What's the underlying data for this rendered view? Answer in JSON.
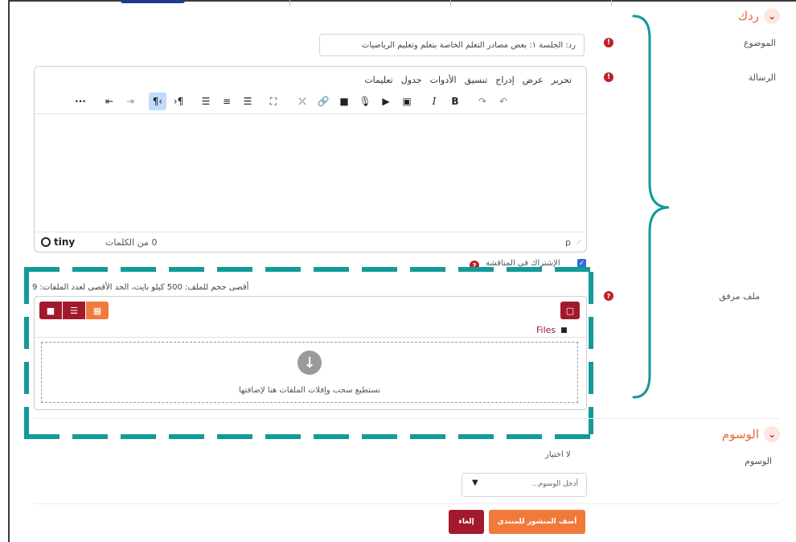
{
  "reply_section": {
    "title": "ردك",
    "subject_label": "الموضوع",
    "subject_value": "رد: الجلسة ١: بعض مصادر التعلم الخاصة بتعلم وتعليم الرياضيات",
    "message_label": "الرسالة",
    "attachment_label": "ملف مرفق"
  },
  "editor": {
    "menu": [
      "تحرير",
      "عرض",
      "إدراج",
      "تنسيق",
      "الأدوات",
      "جدول",
      "تعليمات"
    ],
    "word_count": "0 من الكلمات",
    "brand": "tiny",
    "path": "p"
  },
  "subscribe": {
    "label": "الإشتراك في المناقشة",
    "checked": true
  },
  "filepicker": {
    "limits": "أقصى حجم للملف: 500 كيلو بايت، الحد الأقصى لعدد الملفات: 9",
    "folder_name": "Files",
    "drop_text": "تستطيع سحب وإفلات الملفات هنا لإضافتها"
  },
  "tags_section": {
    "title": "الوسوم",
    "tags_label": "الوسوم",
    "no_selection": "لا اختيار",
    "tags_placeholder": "أدخل الوسوم..."
  },
  "actions": {
    "submit_label": "أضف المنشور للمنتدى",
    "cancel_label": "إلغاء"
  },
  "colors": {
    "accent_orange": "#f07a3a",
    "brand_dark_red": "#a3192c",
    "annotation_teal": "#139a9a"
  },
  "icons": [
    "undo-icon",
    "redo-icon",
    "bold-icon",
    "italic-icon",
    "image-icon",
    "media-icon",
    "record-audio-icon",
    "record-video-icon",
    "link-icon",
    "unlink-icon",
    "fullscreen-icon",
    "align-left-icon",
    "align-center-icon",
    "align-right-icon",
    "ltr-icon",
    "rtl-icon",
    "indent-icon",
    "outdent-icon",
    "more-icon",
    "file-icon",
    "folder-icon",
    "list-view-icon",
    "grid-view-icon",
    "download-icon"
  ]
}
